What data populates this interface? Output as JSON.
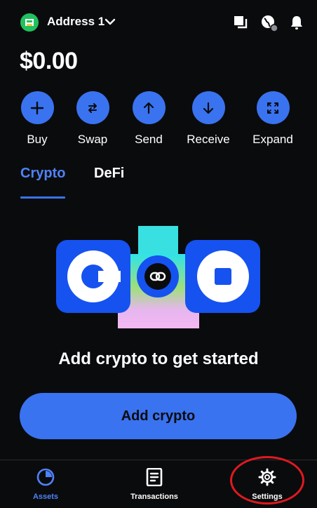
{
  "header": {
    "account_name": "Address 1",
    "icons": [
      "account-avatar-icon",
      "chevron-down-icon",
      "copy-icon",
      "globe-icon",
      "bell-icon"
    ]
  },
  "balance": "$0.00",
  "actions": [
    {
      "label": "Buy",
      "icon": "plus-icon"
    },
    {
      "label": "Swap",
      "icon": "swap-icon"
    },
    {
      "label": "Send",
      "icon": "arrow-up-icon"
    },
    {
      "label": "Receive",
      "icon": "arrow-down-icon"
    },
    {
      "label": "Expand",
      "icon": "expand-icon"
    }
  ],
  "tabs": [
    {
      "label": "Crypto",
      "active": true
    },
    {
      "label": "DeFi",
      "active": false
    }
  ],
  "empty_state": {
    "title": "Add crypto to get started",
    "button_label": "Add crypto"
  },
  "bottom_nav": [
    {
      "label": "Assets",
      "icon": "pie-chart-icon",
      "active": true
    },
    {
      "label": "Transactions",
      "icon": "document-icon",
      "active": false
    },
    {
      "label": "Settings",
      "icon": "gear-icon",
      "active": false
    }
  ],
  "colors": {
    "background": "#0a0b0d",
    "accent": "#3a73f0",
    "accent_text": "#4f82f7",
    "annotation": "#e0191f"
  }
}
